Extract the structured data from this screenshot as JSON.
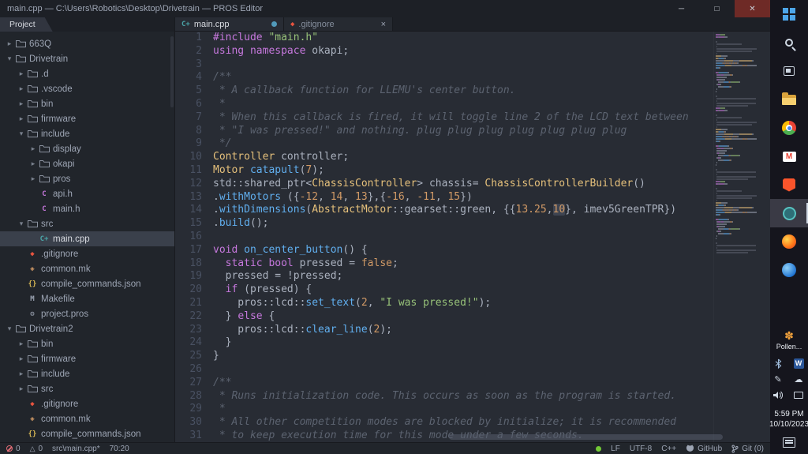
{
  "window": {
    "title": "main.cpp — C:\\Users\\Robotics\\Desktop\\Drivetrain — PROS Editor",
    "controls": {
      "minimize": "─",
      "maximize": "□",
      "close": "✕"
    }
  },
  "sidebar": {
    "tab_label": "Project",
    "items": [
      {
        "label": "663Q",
        "depth": 0,
        "kind": "folder",
        "expanded": false
      },
      {
        "label": "Drivetrain",
        "depth": 0,
        "kind": "folder",
        "expanded": true
      },
      {
        "label": ".d",
        "depth": 1,
        "kind": "folder",
        "expanded": false
      },
      {
        "label": ".vscode",
        "depth": 1,
        "kind": "folder",
        "expanded": false
      },
      {
        "label": "bin",
        "depth": 1,
        "kind": "folder",
        "expanded": false
      },
      {
        "label": "firmware",
        "depth": 1,
        "kind": "folder",
        "expanded": false
      },
      {
        "label": "include",
        "depth": 1,
        "kind": "folder",
        "expanded": true
      },
      {
        "label": "display",
        "depth": 2,
        "kind": "folder",
        "expanded": false
      },
      {
        "label": "okapi",
        "depth": 2,
        "kind": "folder",
        "expanded": false
      },
      {
        "label": "pros",
        "depth": 2,
        "kind": "folder",
        "expanded": false
      },
      {
        "label": "api.h",
        "depth": 2,
        "kind": "file",
        "icon": "h"
      },
      {
        "label": "main.h",
        "depth": 2,
        "kind": "file",
        "icon": "h"
      },
      {
        "label": "src",
        "depth": 1,
        "kind": "folder",
        "expanded": true
      },
      {
        "label": "main.cpp",
        "depth": 2,
        "kind": "file",
        "icon": "cpp",
        "selected": true
      },
      {
        "label": ".gitignore",
        "depth": 1,
        "kind": "file",
        "icon": "git"
      },
      {
        "label": "common.mk",
        "depth": 1,
        "kind": "file",
        "icon": "mk"
      },
      {
        "label": "compile_commands.json",
        "depth": 1,
        "kind": "file",
        "icon": "json"
      },
      {
        "label": "Makefile",
        "depth": 1,
        "kind": "file",
        "icon": "make"
      },
      {
        "label": "project.pros",
        "depth": 1,
        "kind": "file",
        "icon": "pros"
      },
      {
        "label": "Drivetrain2",
        "depth": 0,
        "kind": "folder",
        "expanded": true
      },
      {
        "label": "bin",
        "depth": 1,
        "kind": "folder",
        "expanded": false
      },
      {
        "label": "firmware",
        "depth": 1,
        "kind": "folder",
        "expanded": false
      },
      {
        "label": "include",
        "depth": 1,
        "kind": "folder",
        "expanded": false
      },
      {
        "label": "src",
        "depth": 1,
        "kind": "folder",
        "expanded": false
      },
      {
        "label": ".gitignore",
        "depth": 1,
        "kind": "file",
        "icon": "git"
      },
      {
        "label": "common.mk",
        "depth": 1,
        "kind": "file",
        "icon": "mk"
      },
      {
        "label": "compile_commands.json",
        "depth": 1,
        "kind": "file",
        "icon": "json"
      }
    ]
  },
  "tab_bar": {
    "close_glyph": "×",
    "tabs": [
      {
        "label": "main.cpp",
        "icon": "cpp",
        "active": true,
        "modified": true
      },
      {
        "label": ".gitignore",
        "icon": "git",
        "active": false,
        "modified": false
      }
    ]
  },
  "editor": {
    "first_line": 1,
    "lines": [
      [
        [
          "k",
          "#include"
        ],
        [
          "d",
          " "
        ],
        [
          "s",
          "\"main.h\""
        ]
      ],
      [
        [
          "k",
          "using"
        ],
        [
          "d",
          " "
        ],
        [
          "k",
          "namespace"
        ],
        [
          "d",
          " okapi;"
        ]
      ],
      [],
      [
        [
          "c",
          "/**"
        ]
      ],
      [
        [
          "c",
          " * A callback function for LLEMU's center button."
        ]
      ],
      [
        [
          "c",
          " *"
        ]
      ],
      [
        [
          "c",
          " * When this callback is fired, it will toggle line 2 of the LCD text between"
        ]
      ],
      [
        [
          "c",
          " * \"I was pressed!\" and nothing. plug plug plug plug plug plug plug"
        ]
      ],
      [
        [
          "c",
          " */"
        ]
      ],
      [
        [
          "t",
          "Controller"
        ],
        [
          "d",
          " controller;"
        ]
      ],
      [
        [
          "t",
          "Motor"
        ],
        [
          "d",
          " "
        ],
        [
          "f",
          "catapult"
        ],
        [
          "d",
          "("
        ],
        [
          "n",
          "7"
        ],
        [
          "d",
          ");"
        ]
      ],
      [
        [
          "d",
          "std::shared_ptr<"
        ],
        [
          "t",
          "ChassisController"
        ],
        [
          "d",
          "> chassis= "
        ],
        [
          "t",
          "ChassisControllerBuilder"
        ],
        [
          "d",
          "()"
        ]
      ],
      [
        [
          "d",
          "."
        ],
        [
          "f",
          "withMotors"
        ],
        [
          "d",
          " ({"
        ],
        [
          "n",
          "-12"
        ],
        [
          "d",
          ", "
        ],
        [
          "n",
          "14"
        ],
        [
          "d",
          ", "
        ],
        [
          "n",
          "13"
        ],
        [
          "d",
          "},{"
        ],
        [
          "n",
          "-16"
        ],
        [
          "d",
          ", "
        ],
        [
          "n",
          "-11"
        ],
        [
          "d",
          ", "
        ],
        [
          "n",
          "15"
        ],
        [
          "d",
          "})"
        ]
      ],
      [
        [
          "d",
          "."
        ],
        [
          "f",
          "withDimensions"
        ],
        [
          "d",
          "("
        ],
        [
          "t",
          "AbstractMotor"
        ],
        [
          "d",
          "::gearset::green, {{"
        ],
        [
          "n",
          "13.25"
        ],
        [
          "d",
          ","
        ],
        [
          "n",
          "10",
          "sel"
        ],
        [
          "d",
          "}, imev5GreenTPR})"
        ]
      ],
      [
        [
          "d",
          "."
        ],
        [
          "f",
          "build"
        ],
        [
          "d",
          "();"
        ]
      ],
      [],
      [
        [
          "k",
          "void"
        ],
        [
          "d",
          " "
        ],
        [
          "f",
          "on_center_button"
        ],
        [
          "d",
          "() {"
        ]
      ],
      [
        [
          "d",
          "  "
        ],
        [
          "k",
          "static"
        ],
        [
          "d",
          " "
        ],
        [
          "k",
          "bool"
        ],
        [
          "d",
          " pressed = "
        ],
        [
          "n",
          "false"
        ],
        [
          "d",
          ";"
        ]
      ],
      [
        [
          "d",
          "  pressed = !pressed;"
        ]
      ],
      [
        [
          "d",
          "  "
        ],
        [
          "k",
          "if"
        ],
        [
          "d",
          " (pressed) {"
        ]
      ],
      [
        [
          "d",
          "    pros::lcd::"
        ],
        [
          "f",
          "set_text"
        ],
        [
          "d",
          "("
        ],
        [
          "n",
          "2"
        ],
        [
          "d",
          ", "
        ],
        [
          "s",
          "\"I was pressed!\""
        ],
        [
          "d",
          ");"
        ]
      ],
      [
        [
          "d",
          "  } "
        ],
        [
          "k",
          "else"
        ],
        [
          "d",
          " {"
        ]
      ],
      [
        [
          "d",
          "    pros::lcd::"
        ],
        [
          "f",
          "clear_line"
        ],
        [
          "d",
          "("
        ],
        [
          "n",
          "2"
        ],
        [
          "d",
          ");"
        ]
      ],
      [
        [
          "d",
          "  }"
        ]
      ],
      [
        [
          "d",
          "}"
        ]
      ],
      [],
      [
        [
          "c",
          "/**"
        ]
      ],
      [
        [
          "c",
          " * Runs initialization code. This occurs as soon as the program is started."
        ]
      ],
      [
        [
          "c",
          " *"
        ]
      ],
      [
        [
          "c",
          " * All other competition modes are blocked by initialize; it is recommended"
        ]
      ],
      [
        [
          "c",
          " * to keep execution time for this mode under a few seconds."
        ]
      ]
    ]
  },
  "status_bar": {
    "errors": "0",
    "warnings": "0",
    "file": "src\\main.cpp*",
    "cursor": "70:20",
    "line_ending": "LF",
    "encoding": "UTF-8",
    "language": "C++",
    "github_label": "GitHub",
    "git_label": "Git (0)"
  },
  "taskbar": {
    "apps": [
      {
        "name": "start"
      },
      {
        "name": "search"
      },
      {
        "name": "task-view"
      },
      {
        "name": "file-explorer"
      },
      {
        "name": "chrome"
      },
      {
        "name": "gmail"
      },
      {
        "name": "brave"
      },
      {
        "name": "pros-editor",
        "active": true
      },
      {
        "name": "firefox"
      },
      {
        "name": "edge"
      }
    ],
    "widget_label": "Pollen...",
    "tray": [
      {
        "name": "bluetooth"
      },
      {
        "name": "word"
      },
      {
        "name": "pen"
      },
      {
        "name": "onedrive"
      },
      {
        "name": "speaker"
      },
      {
        "name": "network"
      }
    ],
    "clock": {
      "time": "5:59 PM",
      "date": "10/10/2023"
    }
  }
}
